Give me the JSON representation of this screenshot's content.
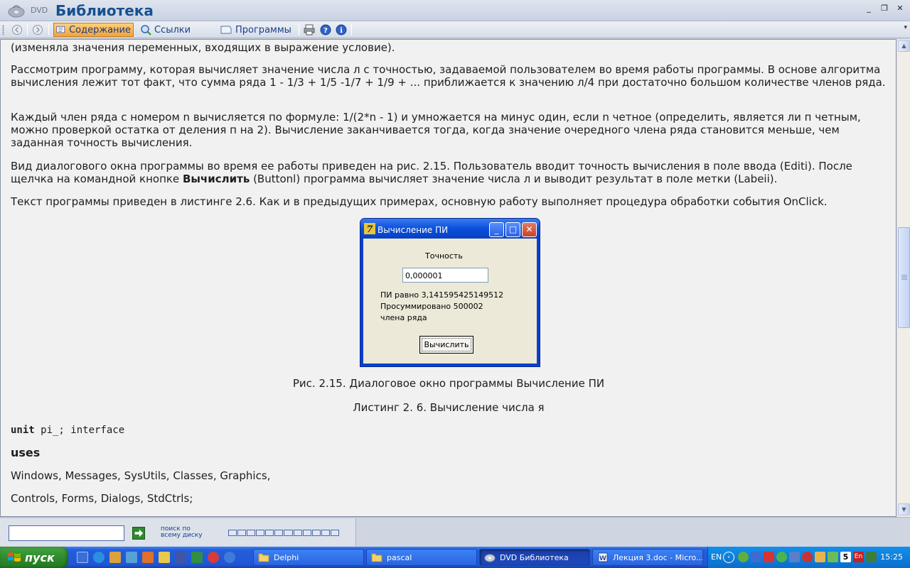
{
  "window": {
    "brand_small": "DVD",
    "title": "Библиотека",
    "minimize_glyph": "_",
    "restore_glyph": "❐",
    "close_glyph": "✕"
  },
  "toolbar": {
    "contents_label": "Содержание",
    "links_label": "Ссылки",
    "programs_label": "Программы",
    "overflow_glyph": "▾"
  },
  "content": {
    "paragraphs": [
      "(изменяла значения переменных, входящих в выражение условие).",
      "Рассмотрим программу, которая вычисляет значение числа л с точностью, задаваемой пользователем во время работы программы. В основе алгоритма вычисления лежит тот факт, что сумма ряда 1 - 1/3 + 1/5 -1/7 + 1/9 + ... приближается к значению л/4 при достаточно большом количестве членов ряда.",
      "Каждый член ряда с номером n вычисляется по формуле: 1/(2*n - 1) и умножается на минус один, если n четное (определить, является ли п четным, можно проверкой остатка от деления п на 2). Вычисление заканчивается тогда, когда значение очередного члена ряда становится меньше, чем заданная точность вычисления.",
      "Текст программы приведен в листинге 2.6. Как и в предыдущих примерах, основную работу выполняет процедура обработки события OnClick."
    ],
    "para4": {
      "part1": "Вид диалогового окна программы во время ее работы приведен на рис. 2.15. Пользователь вводит точность вычисления в поле ввода (Editi). После щелчка на командной кнопке ",
      "bold": "Вычислить",
      "part2": " (Buttonl) программа вычисляет значение числа л и выводит результат в поле метки (Labeii)."
    },
    "figure_caption": {
      "prefix": "Рис. 2.15.",
      "middle": " Диалоговое окно программы ",
      "bold": "Вычисление ПИ"
    },
    "listing_caption": "Листинг 2. 6. Вычисление числа я",
    "code": {
      "keyword_unit": "unit",
      "unit_rest": " pi_; interface",
      "uses": "uses",
      "line1": "Windows, Messages, SysUtils, Classes, Graphics,",
      "line2": "Controls, Forms, Dialogs, StdCtrls;"
    }
  },
  "dialog": {
    "title": "Вычисление ПИ",
    "precision_label": "Точность",
    "precision_value": "0,000001",
    "result_line1": "ПИ равно 3,141595425149512",
    "result_line2": "Просуммировано 500002",
    "result_line3": "члена ряда",
    "calc_button": "Вычислить",
    "minimize_glyph": "_",
    "maximize_glyph": "□",
    "close_glyph": "✕"
  },
  "search": {
    "input_value": "",
    "scope_line1": "поиск по",
    "scope_line2": "всему диску",
    "progress_cells": 12
  },
  "taskbar": {
    "start_label": "пуск",
    "tasks": [
      {
        "label": "Delphi",
        "active": false
      },
      {
        "label": "pascal",
        "active": false
      },
      {
        "label": "DVD Библиотека",
        "active": true
      },
      {
        "label": "Лекция 3.doc - Micro...",
        "active": false
      }
    ],
    "lang": "EN",
    "clock": "15:25",
    "tray_badge": "5",
    "tray_badge2": "En"
  },
  "colors": {
    "accent_button": "#f3a33b",
    "taskbar": "#245edb",
    "start_green": "#2f8b2c",
    "dialog_frame": "#0a3fd0"
  }
}
